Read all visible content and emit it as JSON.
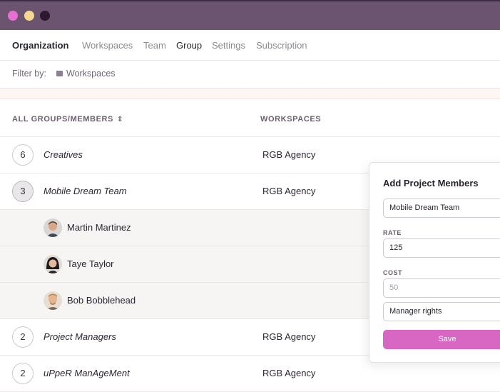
{
  "window": {
    "controls": [
      "close",
      "minimize",
      "maximize"
    ],
    "colors": {
      "titlebar": "#6b5470",
      "close": "#e86ed0",
      "minimize": "#f4d98f",
      "maximize": "#2f1730"
    }
  },
  "nav": {
    "items": [
      {
        "label": "Organization",
        "state": "brand"
      },
      {
        "label": "Workspaces",
        "state": "default"
      },
      {
        "label": "Team",
        "state": "default"
      },
      {
        "label": "Group",
        "state": "active"
      },
      {
        "label": "Settings",
        "state": "default"
      },
      {
        "label": "Subscription",
        "state": "default"
      }
    ]
  },
  "filter": {
    "label": "Filter by:",
    "chip_icon": "briefcase-icon",
    "chip_label": "Workspaces"
  },
  "table": {
    "columns": [
      "ALL GROUPS/MEMBERS",
      "WORKSPACES"
    ],
    "sort_icon": "sort-updown-icon",
    "rows": [
      {
        "type": "group",
        "count": "6",
        "name": "Creatives",
        "workspace": "RGB Agency",
        "selected": false
      },
      {
        "type": "group",
        "count": "3",
        "name": "Mobile Dream Team",
        "workspace": "RGB Agency",
        "selected": true
      },
      {
        "type": "member",
        "name": "Martin Martinez",
        "avatar": "avatar-martin"
      },
      {
        "type": "member",
        "name": "Taye Taylor",
        "avatar": "avatar-taye"
      },
      {
        "type": "member",
        "name": "Bob Bobblehead",
        "avatar": "avatar-bob"
      },
      {
        "type": "group",
        "count": "2",
        "name": "Project Managers",
        "workspace": "RGB Agency",
        "selected": false
      },
      {
        "type": "group",
        "count": "2",
        "name": "uPpeR ManAgeMent",
        "workspace": "RGB Agency",
        "selected": false
      }
    ]
  },
  "panel": {
    "title": "Add Project Members",
    "group_value": "Mobile Dream Team",
    "rate_label": "RATE",
    "rate_value": "125",
    "cost_label": "COST",
    "cost_placeholder": "50",
    "rights_value": "Manager rights",
    "save_label": "Save",
    "accent": "#d767c2"
  }
}
